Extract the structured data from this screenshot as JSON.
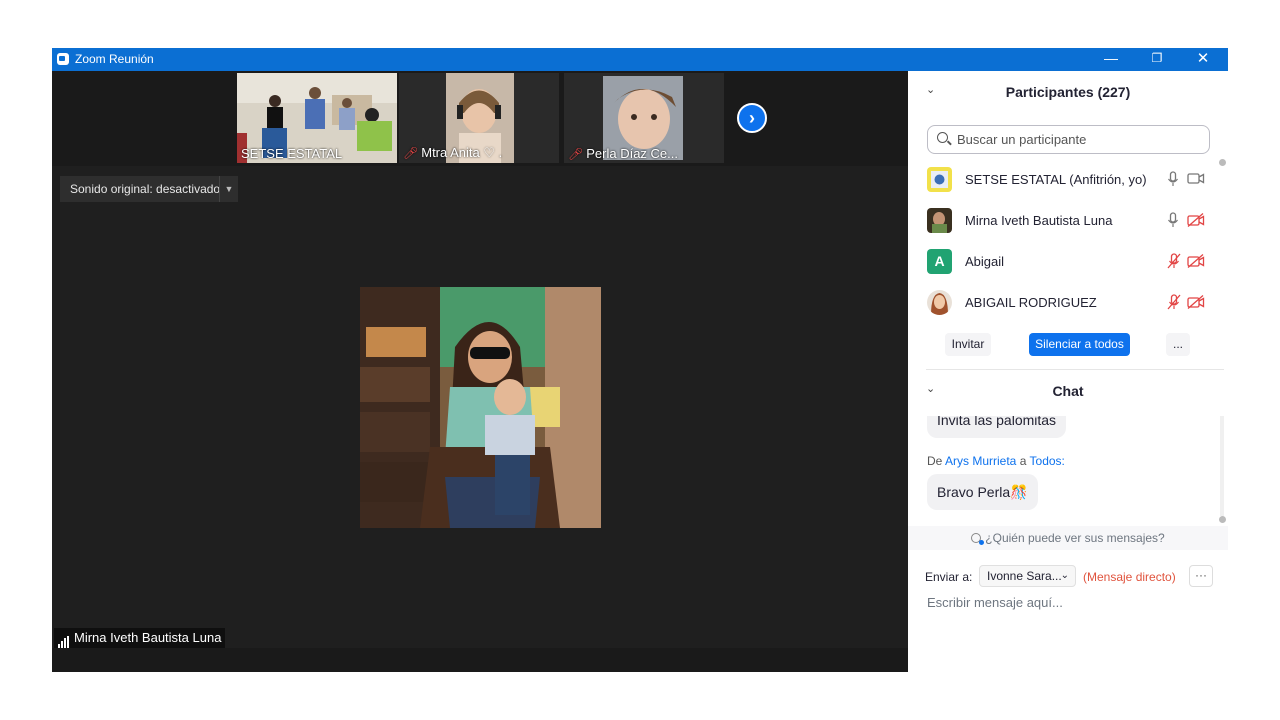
{
  "window": {
    "title": "Zoom Reunión",
    "controls": [
      "minimize",
      "restore",
      "close"
    ]
  },
  "thumbnails": [
    {
      "label": "SETSE ESTATAL",
      "muted": false
    },
    {
      "label": "Mtra Anita ♡ .",
      "muted": true
    },
    {
      "label": "Perla Díaz Ce...",
      "muted": true
    }
  ],
  "sound": {
    "label": "Sonido original: desactivado"
  },
  "main_video": {
    "speaker_label": "Mirna Iveth Bautista Luna"
  },
  "participants": {
    "title": "Participantes (227)",
    "search_placeholder": "Buscar un participante",
    "list": [
      {
        "name": "SETSE ESTATAL (Anfitrión, yo)",
        "mic_muted": false,
        "cam_off": false
      },
      {
        "name": "Mirna Iveth Bautista Luna",
        "mic_muted": false,
        "cam_off": true
      },
      {
        "name": "Abigail",
        "avatar_letter": "A",
        "mic_muted": true,
        "cam_off": true
      },
      {
        "name": "ABIGAIL RODRIGUEZ",
        "mic_muted": true,
        "cam_off": true
      }
    ],
    "invite_label": "Invitar",
    "mute_all_label": "Silenciar a todos",
    "more_label": "..."
  },
  "chat": {
    "title": "Chat",
    "messages": [
      {
        "text": "Invita las palomitas"
      },
      {
        "from_prefix": "De",
        "from": "Arys Murrieta",
        "connector": "a",
        "to": "Todos:",
        "text": "Bravo Perla🎊"
      }
    ],
    "who_sees": "¿Quién puede ver sus mensajes?",
    "send_to_label": "Enviar a:",
    "send_to_value": "Ivonne Sara...",
    "direct_label": "(Mensaje directo)",
    "more_label": "···",
    "input_placeholder": "Escribir mensaje aquí..."
  },
  "colors": {
    "accent": "#0e72ed",
    "titlebar": "#0b6fd3",
    "muted_red": "#e24545"
  }
}
